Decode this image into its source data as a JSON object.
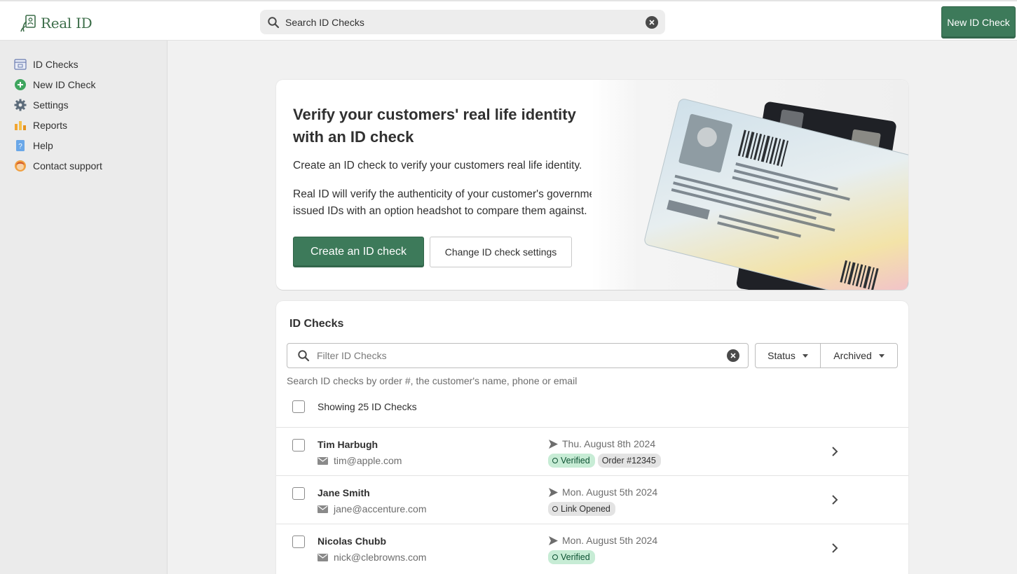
{
  "app": {
    "name": "Real ID"
  },
  "header": {
    "search_value": "Search ID Checks",
    "new_button": "New ID Check"
  },
  "sidebar": {
    "items": [
      {
        "label": "ID Checks",
        "icon": "id-checks-icon"
      },
      {
        "label": "New ID Check",
        "icon": "plus-circle-icon"
      },
      {
        "label": "Settings",
        "icon": "gear-icon"
      },
      {
        "label": "Reports",
        "icon": "reports-icon"
      },
      {
        "label": "Help",
        "icon": "help-icon"
      },
      {
        "label": "Contact support",
        "icon": "support-avatar-icon"
      }
    ]
  },
  "hero": {
    "title": "Verify your customers' real life identity with an ID check",
    "p1": "Create an ID check to verify your customers real life identity.",
    "p2": "Real ID will verify the authenticity of your customer's government issued IDs with an option headshot to compare them against.",
    "primary_button": "Create an ID check",
    "secondary_button": "Change ID check settings"
  },
  "list": {
    "title": "ID Checks",
    "filter_placeholder": "Filter ID Checks",
    "status_label": "Status",
    "archived_label": "Archived",
    "help_text": "Search ID checks by order #, the customer's name, phone or email",
    "showing": "Showing 25 ID Checks",
    "rows": [
      {
        "name": "Tim Harbugh",
        "email": "tim@apple.com",
        "date": "Thu. August 8th 2024",
        "status": "Verified",
        "order": "Order #12345"
      },
      {
        "name": "Jane Smith",
        "email": "jane@accenture.com",
        "date": "Mon. August 5th 2024",
        "status": "Link Opened"
      },
      {
        "name": "Nicolas Chubb",
        "email": "nick@clebrowns.com",
        "date": "Mon. August 5th 2024",
        "status": "Verified"
      }
    ]
  },
  "colors": {
    "brand": "#3d7a5a",
    "verified_bg": "#c7ecd5",
    "neutral_bg": "#e3e3e3"
  }
}
